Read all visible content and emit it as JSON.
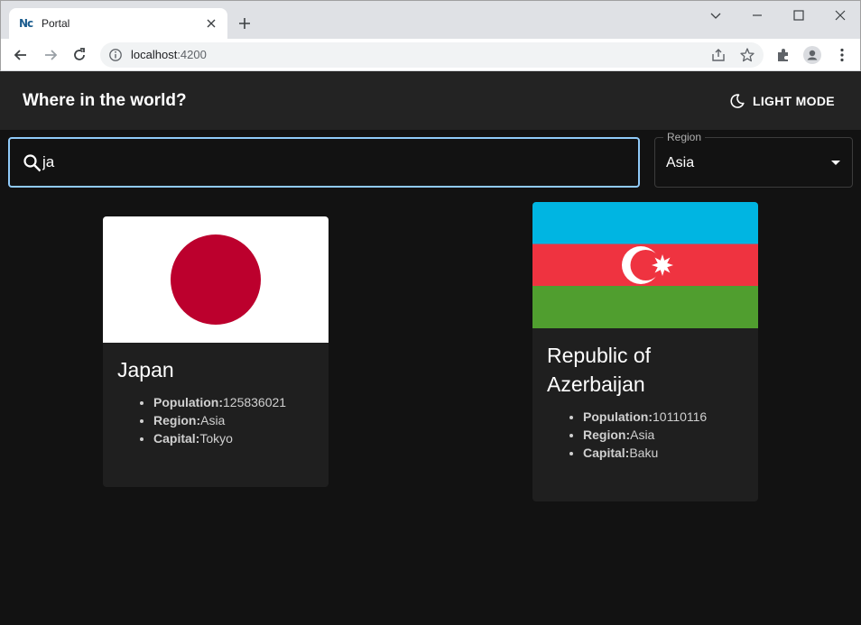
{
  "browser": {
    "tab_title": "Portal",
    "favicon_text": "Nc",
    "url_host": "localhost",
    "url_port": ":4200",
    "icons": [
      "back-icon",
      "forward-icon",
      "reload-icon",
      "info-icon",
      "share-icon",
      "star-icon",
      "extensions-icon",
      "profile-icon",
      "menu-icon",
      "minimize-icon",
      "maximize-icon",
      "close-icon",
      "chevron-down-icon",
      "new-tab-icon"
    ]
  },
  "header": {
    "title": "Where in the world?",
    "mode_label": "LIGHT MODE",
    "mode_icon": "moon-icon"
  },
  "search": {
    "value": "ja",
    "icon": "search-icon"
  },
  "filter": {
    "label": "Region",
    "value": "Asia"
  },
  "labels": {
    "population": "Population:",
    "region": "Region:",
    "capital": "Capital:"
  },
  "countries": [
    {
      "name": "Japan",
      "population": "125836021",
      "region": "Asia",
      "capital": "Tokyo",
      "flag": "japan-flag"
    },
    {
      "name": "Republic of Azerbaijan",
      "population": "10110116",
      "region": "Asia",
      "capital": "Baku",
      "flag": "azerbaijan-flag"
    }
  ],
  "colors": {
    "background": "#121212",
    "header": "#232323",
    "card": "#1f1f1f",
    "search_focus": "#90caf9",
    "japan_red": "#bc002d",
    "aze_blue": "#00b5e2",
    "aze_red": "#ef3340",
    "aze_green": "#509e2f"
  }
}
